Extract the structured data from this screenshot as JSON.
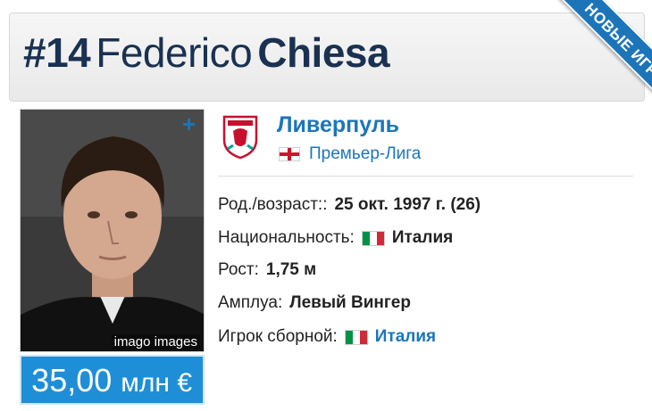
{
  "header": {
    "number": "#14",
    "first_name": "Federico",
    "last_name": "Chiesa",
    "ribbon": "НОВЫЕ ИГРОКИ"
  },
  "photo": {
    "credit": "imago images",
    "plus_icon": "plus-icon"
  },
  "market_value": {
    "amount": "35,00",
    "unit": "млн €"
  },
  "club": {
    "name": "Ливерпуль",
    "logo_icon": "club-crest-icon",
    "league": "Премьер-Лига",
    "league_flag": "england-flag-icon"
  },
  "info": {
    "birth_label": "Род./возраст::",
    "birth_value": "25 окт. 1997 г. (26)",
    "nationality_label": "Национальность:",
    "nationality_value": "Италия",
    "height_label": "Рост:",
    "height_value": "1,75 м",
    "position_label": "Амплуа:",
    "position_value": "Левый Вингер",
    "national_team_label": "Игрок сборной:",
    "national_team_value": "Италия"
  },
  "colors": {
    "accent": "#1d75b9",
    "title": "#1a3151",
    "value_bg": "#1e8ed6",
    "italy": [
      "#009246",
      "#ffffff",
      "#ce2b37"
    ]
  }
}
